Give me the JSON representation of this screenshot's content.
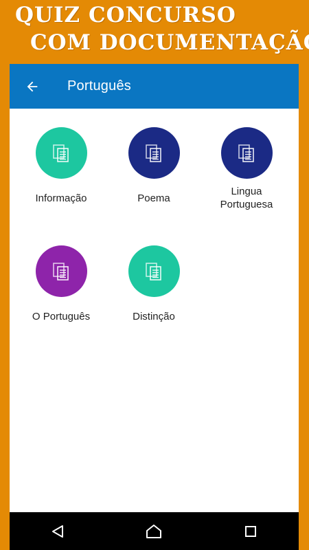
{
  "banner": {
    "line1": "QUIZ CONCURSO",
    "line2": "COM DOCUMENTAÇÃO"
  },
  "appbar": {
    "title": "Português",
    "back_icon": "arrow-left-icon"
  },
  "colors": {
    "banner_bg": "#e48a05",
    "appbar_bg": "#0a76c2",
    "teal": "#1dc7a0",
    "navy": "#1b2a85",
    "purple": "#8e24aa"
  },
  "topics": [
    {
      "label": "Informação",
      "color": "#1dc7a0",
      "icon": "document-icon"
    },
    {
      "label": "Poema",
      "color": "#1b2a85",
      "icon": "document-icon"
    },
    {
      "label": "Lingua\nPortuguesa",
      "color": "#1b2a85",
      "icon": "document-icon"
    },
    {
      "label": "O Português",
      "color": "#8e24aa",
      "icon": "document-icon"
    },
    {
      "label": "Distinção",
      "color": "#1dc7a0",
      "icon": "document-icon"
    }
  ],
  "navbar": {
    "back_icon": "nav-back-icon",
    "home_icon": "nav-home-icon",
    "recents_icon": "nav-recents-icon"
  }
}
